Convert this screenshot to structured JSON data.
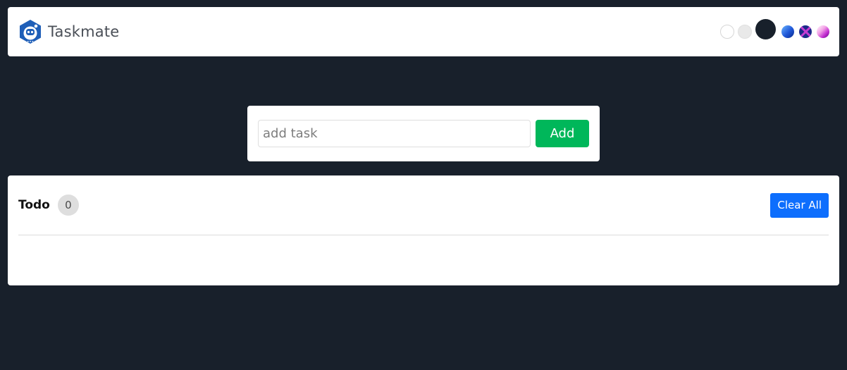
{
  "header": {
    "brand": "Taskmate",
    "logo_icon": "robot-logo-icon",
    "themes": [
      {
        "name": "light",
        "color": "#ffffff"
      },
      {
        "name": "grey",
        "color": "#e9e9e9"
      },
      {
        "name": "dark",
        "color": "#18202b"
      },
      {
        "name": "blue",
        "color": "#1f57d8"
      },
      {
        "name": "night",
        "color": "#1c2a8a"
      },
      {
        "name": "pink",
        "color": "#c12cd0"
      }
    ]
  },
  "add_task": {
    "placeholder": "add task",
    "value": "",
    "button_label": "Add",
    "button_color": "#00b75a"
  },
  "todo": {
    "title": "Todo",
    "count": "0",
    "clear_label": "Clear All",
    "clear_color": "#0d6efd",
    "items": []
  },
  "colors": {
    "background": "#18202b",
    "card": "#ffffff"
  }
}
